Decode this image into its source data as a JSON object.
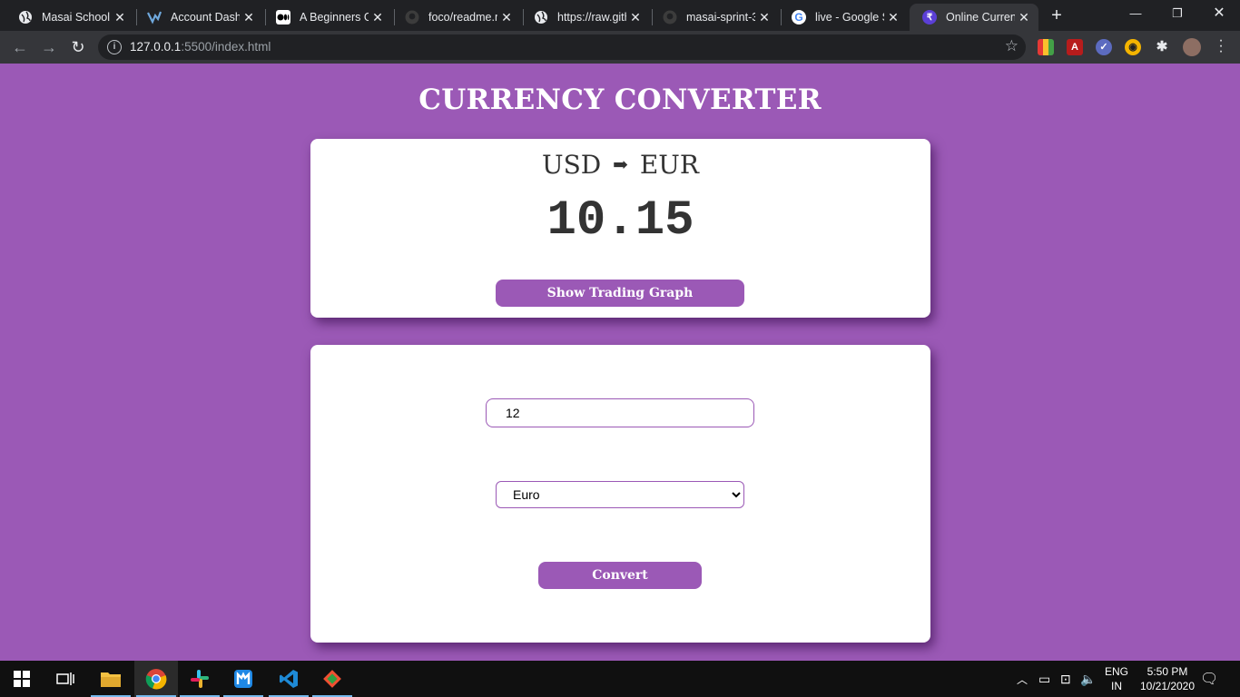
{
  "browser": {
    "tabs": [
      {
        "title": "Masai School",
        "icon": "globe-icon"
      },
      {
        "title": "Account Dashb",
        "icon": "dashboard-logo-icon"
      },
      {
        "title": "A Beginners Gu",
        "icon": "medium-logo-icon"
      },
      {
        "title": "foco/readme.m",
        "icon": "github-icon"
      },
      {
        "title": "https://raw.gith",
        "icon": "globe-icon"
      },
      {
        "title": "masai-sprint-3",
        "icon": "github-icon"
      },
      {
        "title": "live - Google S",
        "icon": "google-icon"
      },
      {
        "title": "Online Curren",
        "icon": "rupee-icon"
      }
    ],
    "url_host": "127.0.0.1",
    "url_rest": ":5500/index.html"
  },
  "page": {
    "title": "CURRENCY CONVERTER",
    "from": "USD",
    "arrow": "➡",
    "to": "EUR",
    "result": "10.15",
    "graph_button": "Show Trading Graph",
    "amount_value": "12",
    "selected_currency": "Euro",
    "convert_button": "Convert"
  },
  "taskbar": {
    "lang_line1": "ENG",
    "lang_line2": "IN",
    "time": "5:50 PM",
    "date": "10/21/2020"
  },
  "colors": {
    "accent": "#9b59b6",
    "card": "#ffffff",
    "tabstrip": "#202124",
    "toolbar": "#35363a"
  }
}
